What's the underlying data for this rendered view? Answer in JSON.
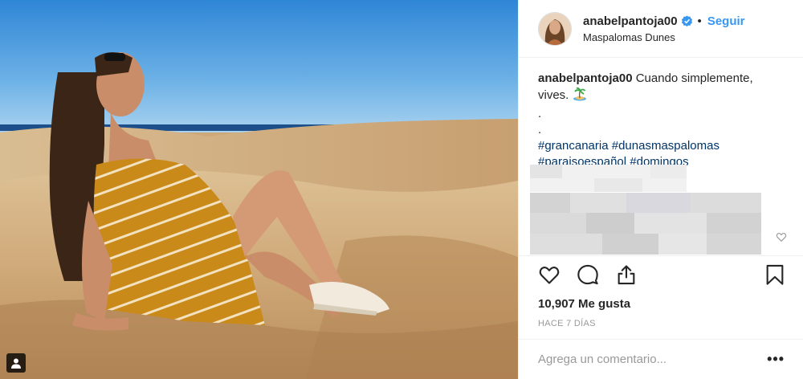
{
  "post": {
    "photo_alt": "",
    "header": {
      "username": "anabelpantoja00",
      "separator": "•",
      "follow_label": "Seguir",
      "location": "Maspalomas Dunes"
    },
    "caption": {
      "username": "anabelpantoja00",
      "text": "Cuando simplemente, vives.",
      "dot1": ".",
      "dot2": ".",
      "hashtags": [
        "#grancanaria",
        "#dunasmaspalomas",
        "#paraisoespañol",
        "#domingos"
      ]
    },
    "likes": "10,907 Me gusta",
    "time": "HACE 7 DÍAS",
    "comment_placeholder": "Agrega un comentario...",
    "more_label": "•••"
  },
  "icons": {
    "verified": "verified-badge-icon",
    "tag": "user-tag-icon",
    "like": "heart-icon",
    "comment": "comment-icon",
    "share": "share-icon",
    "save": "bookmark-icon",
    "comment_like": "small-heart-icon",
    "emoji": "desert-island-emoji"
  },
  "colors": {
    "accent": "#3897f0",
    "hashtag": "#003569",
    "muted": "#999999"
  }
}
